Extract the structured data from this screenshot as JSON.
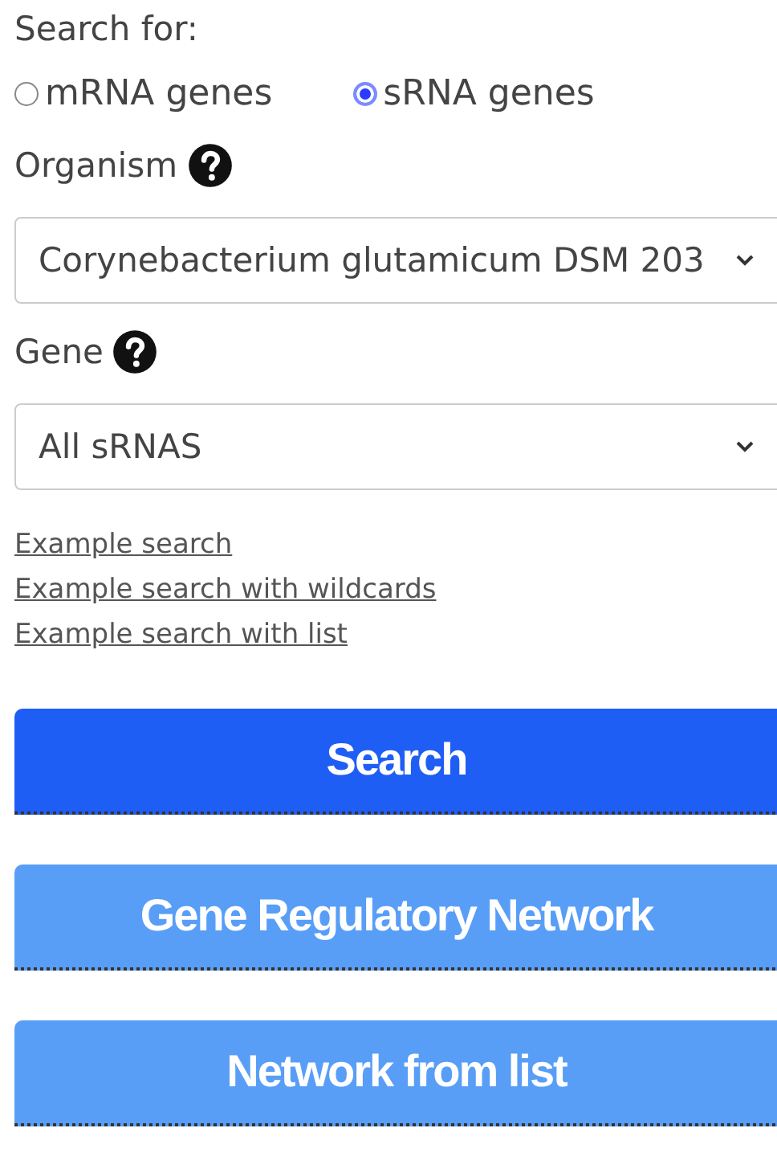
{
  "search_for": {
    "label": "Search for:",
    "options": [
      {
        "label": "mRNA genes",
        "selected": false
      },
      {
        "label": "sRNA genes",
        "selected": true
      }
    ]
  },
  "organism": {
    "label": "Organism",
    "value": "Corynebacterium glutamicum DSM 203"
  },
  "gene": {
    "label": "Gene",
    "value": "All sRNAS"
  },
  "links": [
    "Example search",
    "Example search with wildcards",
    "Example search with list"
  ],
  "buttons": [
    {
      "label": "Search",
      "kind": "primary"
    },
    {
      "label": "Gene Regulatory Network",
      "kind": "secondary"
    },
    {
      "label": "Network from list",
      "kind": "secondary"
    }
  ]
}
